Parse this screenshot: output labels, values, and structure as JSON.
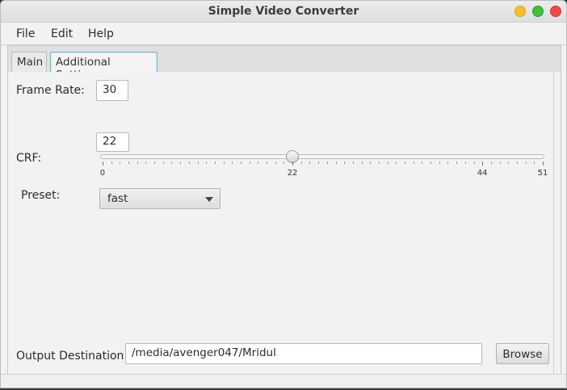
{
  "window": {
    "title": "Simple Video Converter",
    "controls": [
      "minimize",
      "maximize",
      "close"
    ]
  },
  "menu": {
    "items": [
      "File",
      "Edit",
      "Help"
    ]
  },
  "tabs": [
    {
      "label": "Main",
      "selected": false
    },
    {
      "label": "Additional Settings",
      "selected": true
    }
  ],
  "settings": {
    "frame_rate_label": "Frame Rate:",
    "frame_rate_value": "30",
    "crf_label": "CRF:",
    "crf_value": "22",
    "crf_slider": {
      "min": 0,
      "max": 51,
      "value": 22,
      "tick_labels": [
        "0",
        "22",
        "44",
        "51"
      ]
    },
    "preset_label": "Preset:",
    "preset_value": "fast"
  },
  "output": {
    "label": "Output Destination:",
    "path": "/media/avenger047/Mridul",
    "browse_label": "Browse"
  },
  "colors": {
    "window_bg": "#f2f2f2",
    "selected_tab_border": "#7bb4d9",
    "close": "#ee4a4a",
    "minimize": "#f5c02b",
    "maximize": "#3fc13f"
  }
}
